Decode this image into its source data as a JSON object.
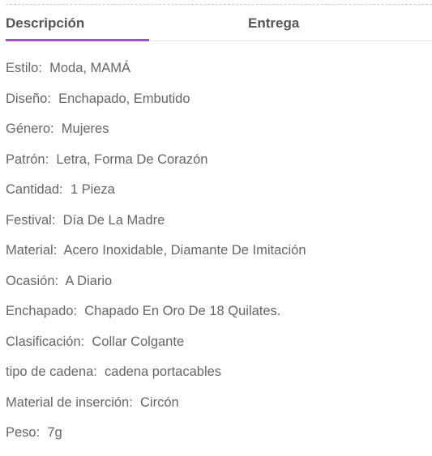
{
  "tabs": [
    {
      "label": "Descripción",
      "active": true
    },
    {
      "label": "Entrega",
      "active": false
    }
  ],
  "accent": "#a64ccc",
  "specs": [
    {
      "label": "Estilo:",
      "value": "Moda, MAMÁ"
    },
    {
      "label": "Diseño:",
      "value": "Enchapado, Embutido"
    },
    {
      "label": "Género:",
      "value": "Mujeres"
    },
    {
      "label": "Patrón:",
      "value": "Letra, Forma De Corazón"
    },
    {
      "label": "Cantidad:",
      "value": "1 Pieza"
    },
    {
      "label": "Festival:",
      "value": "Día De La Madre"
    },
    {
      "label": "Material:",
      "value": "Acero Inoxidable, Diamante De Imitación"
    },
    {
      "label": "Ocasión:",
      "value": "A Diario"
    },
    {
      "label": "Enchapado:",
      "value": "Chapado En Oro De 18 Quilates."
    },
    {
      "label": "Clasificación:",
      "value": "Collar Colgante"
    },
    {
      "label": "tipo de cadena:",
      "value": "cadena portacables"
    },
    {
      "label": "Material de inserción:",
      "value": "Circón"
    },
    {
      "label": "Peso:",
      "value": "7g"
    }
  ]
}
